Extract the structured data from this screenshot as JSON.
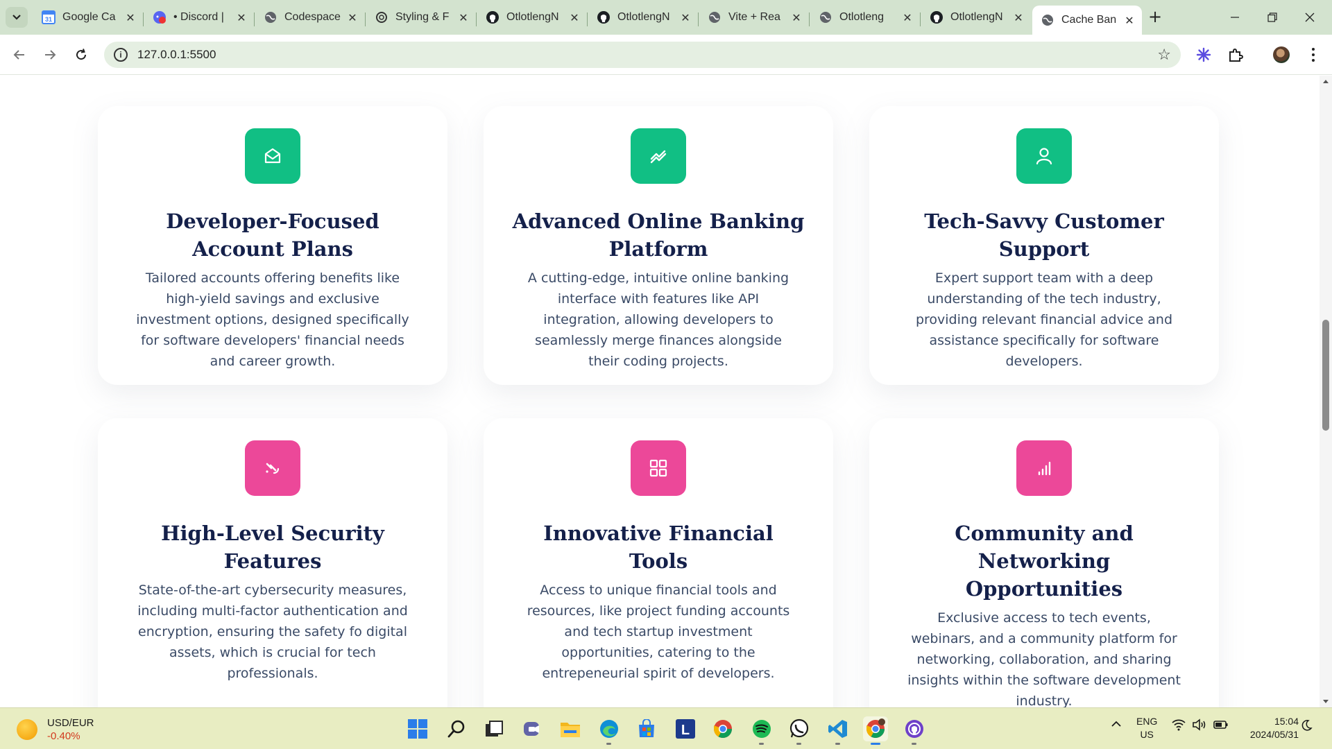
{
  "browser": {
    "tabs": [
      {
        "label": "Google Ca",
        "icon": "google-calendar-icon"
      },
      {
        "label": "• Discord |",
        "icon": "discord-icon"
      },
      {
        "label": "Codespace",
        "icon": "globe-icon"
      },
      {
        "label": "Styling & F",
        "icon": "openai-icon"
      },
      {
        "label": "OtlotlengN",
        "icon": "github-icon"
      },
      {
        "label": "OtlotlengN",
        "icon": "github-icon"
      },
      {
        "label": "Vite + Rea",
        "icon": "globe-icon"
      },
      {
        "label": "Otlotleng",
        "icon": "globe-icon"
      },
      {
        "label": "OtlotlengN",
        "icon": "github-icon"
      },
      {
        "label": "Cache Ban",
        "icon": "globe-icon",
        "active": true
      }
    ],
    "url": "127.0.0.1:5500"
  },
  "features": {
    "cards": [
      {
        "title": "Developer-Focused Account Plans",
        "description": "Tailored accounts offering benefits like high-yield savings and exclusive investment options, designed specifically for software developers' financial needs and career growth.",
        "icon": "envelope-open-icon",
        "color": "#11bf84"
      },
      {
        "title": "Advanced Online Banking Platform",
        "description": "A cutting-edge, intuitive online banking interface with features like API integration, allowing developers to seamlessly merge finances alongside their coding projects.",
        "icon": "trending-up-icon",
        "color": "#11bf84"
      },
      {
        "title": "Tech-Savvy Customer Support",
        "description": "Expert support team with a deep understanding of the tech industry, providing relevant financial advice and assistance specifically for software developers.",
        "icon": "user-icon",
        "color": "#11bf84"
      },
      {
        "title": "High-Level Security Features",
        "description": "State-of-the-art cybersecurity measures, including multi-factor authentication and encryption, ensuring the safety fo digital assets, which is crucial for tech professionals.",
        "icon": "satellite-icon",
        "color": "#ec4899"
      },
      {
        "title": "Innovative Financial Tools",
        "description": "Access to unique financial tools and resources, like project funding accounts and tech startup investment opportunities, catering to the entrepeneurial spirit of developers.",
        "icon": "grid-icon",
        "color": "#ec4899"
      },
      {
        "title": "Community and Networking Opportunities",
        "description": "Exclusive access to tech events, webinars, and a community platform for networking, collaboration, and sharing insights within the software development industry.",
        "icon": "bar-chart-icon",
        "color": "#ec4899"
      }
    ]
  },
  "taskbar": {
    "widget": {
      "pair": "USD/EUR",
      "change": "-0.40%"
    },
    "apps": [
      "windows-start-icon",
      "search-icon",
      "task-view-icon",
      "teams-icon",
      "file-explorer-icon",
      "edge-icon",
      "microsoft-store-icon",
      "l-app-icon",
      "chrome-icon",
      "spotify-icon",
      "whatsapp-icon",
      "vscode-icon",
      "chrome-profile-icon",
      "github-desktop-icon"
    ],
    "language": {
      "line1": "ENG",
      "line2": "US"
    },
    "clock": {
      "time": "15:04",
      "date": "2024/05/31"
    }
  }
}
